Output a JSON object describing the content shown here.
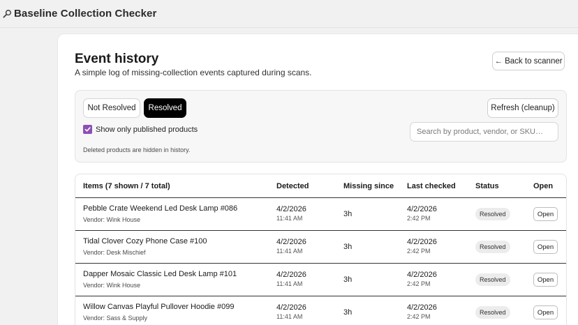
{
  "app": {
    "title": "Baseline Collection Checker",
    "icon": "magnifier-icon"
  },
  "page": {
    "title": "Event history",
    "subtitle": "A simple log of missing-collection events captured during scans.",
    "back_label": "← Back to scanner"
  },
  "filters": {
    "not_resolved_label": "Not Resolved",
    "resolved_label": "Resolved",
    "active": "Resolved",
    "refresh_label": "Refresh (cleanup)",
    "published_only_label": "Show only published products",
    "published_only_checked": true,
    "search_placeholder": "Search by product, vendor, or SKU…",
    "search_value": "",
    "hint": "Deleted products are hidden in history."
  },
  "table": {
    "headers": {
      "items": "Items (7 shown / 7 total)",
      "detected": "Detected",
      "missing_since": "Missing since",
      "last_checked": "Last checked",
      "status": "Status",
      "open": "Open"
    },
    "rows": [
      {
        "name": "Pebble Crate Weekend Led Desk Lamp #086",
        "vendor": "Vendor: Wink House",
        "detected_date": "4/2/2026",
        "detected_time": "11:41 AM",
        "missing_since": "3h",
        "checked_date": "4/2/2026",
        "checked_time": "2:42 PM",
        "status": "Resolved",
        "open_label": "Open"
      },
      {
        "name": "Tidal Clover Cozy Phone Case #100",
        "vendor": "Vendor: Desk Mischief",
        "detected_date": "4/2/2026",
        "detected_time": "11:41 AM",
        "missing_since": "3h",
        "checked_date": "4/2/2026",
        "checked_time": "2:42 PM",
        "status": "Resolved",
        "open_label": "Open"
      },
      {
        "name": "Dapper Mosaic Classic Led Desk Lamp #101",
        "vendor": "Vendor: Wink House",
        "detected_date": "4/2/2026",
        "detected_time": "11:41 AM",
        "missing_since": "3h",
        "checked_date": "4/2/2026",
        "checked_time": "2:42 PM",
        "status": "Resolved",
        "open_label": "Open"
      },
      {
        "name": "Willow Canvas Playful Pullover Hoodie #099",
        "vendor": "Vendor: Sass & Supply",
        "detected_date": "4/2/2026",
        "detected_time": "11:41 AM",
        "missing_since": "3h",
        "checked_date": "4/2/2026",
        "checked_time": "2:42 PM",
        "status": "Resolved",
        "open_label": "Open"
      }
    ]
  },
  "colors": {
    "accent": "#8e4fb5",
    "active_segment": "#000000",
    "badge_bg": "#ececec"
  }
}
